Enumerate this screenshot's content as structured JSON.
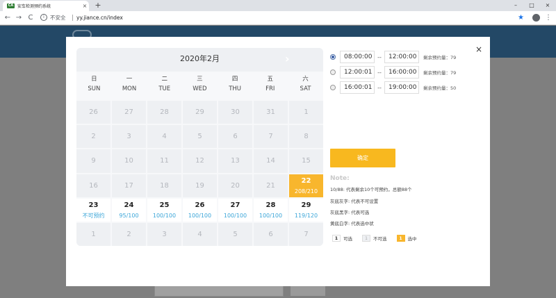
{
  "browser": {
    "tab_title": "安车检测预约系统",
    "favicon_text": "CA",
    "tab_close": "×",
    "new_tab": "+",
    "window_controls": [
      "–",
      "□",
      "×"
    ],
    "nav": {
      "back": "←",
      "forward": "→",
      "reload": "C"
    },
    "security_text": "不安全",
    "url": "yy.jiance.cn/index",
    "bookmark_icon": "★",
    "menu_icon": "⋮"
  },
  "modal": {
    "close": "×",
    "calendar": {
      "title": "2020年2月",
      "next": "›",
      "weekdays": [
        {
          "zh": "日",
          "en": "SUN"
        },
        {
          "zh": "一",
          "en": "MON"
        },
        {
          "zh": "二",
          "en": "TUE"
        },
        {
          "zh": "三",
          "en": "WED"
        },
        {
          "zh": "四",
          "en": "THU"
        },
        {
          "zh": "五",
          "en": "FRI"
        },
        {
          "zh": "六",
          "en": "SAT"
        }
      ],
      "days": [
        {
          "num": "26",
          "state": "disabled"
        },
        {
          "num": "27",
          "state": "disabled"
        },
        {
          "num": "28",
          "state": "disabled"
        },
        {
          "num": "29",
          "state": "disabled"
        },
        {
          "num": "30",
          "state": "disabled"
        },
        {
          "num": "31",
          "state": "disabled"
        },
        {
          "num": "1",
          "state": "disabled"
        },
        {
          "num": "2",
          "state": "disabled"
        },
        {
          "num": "3",
          "state": "disabled"
        },
        {
          "num": "4",
          "state": "disabled"
        },
        {
          "num": "5",
          "state": "disabled"
        },
        {
          "num": "6",
          "state": "disabled"
        },
        {
          "num": "7",
          "state": "disabled"
        },
        {
          "num": "8",
          "state": "disabled"
        },
        {
          "num": "9",
          "state": "disabled"
        },
        {
          "num": "10",
          "state": "disabled"
        },
        {
          "num": "11",
          "state": "disabled"
        },
        {
          "num": "12",
          "state": "disabled"
        },
        {
          "num": "13",
          "state": "disabled"
        },
        {
          "num": "14",
          "state": "disabled"
        },
        {
          "num": "15",
          "state": "disabled"
        },
        {
          "num": "16",
          "state": "disabled"
        },
        {
          "num": "17",
          "state": "disabled"
        },
        {
          "num": "18",
          "state": "disabled"
        },
        {
          "num": "19",
          "state": "disabled"
        },
        {
          "num": "20",
          "state": "disabled"
        },
        {
          "num": "21",
          "state": "disabled"
        },
        {
          "num": "22",
          "state": "selected",
          "quota": "208/210"
        },
        {
          "num": "23",
          "state": "avail",
          "quota": "不可预约"
        },
        {
          "num": "24",
          "state": "avail",
          "quota": "95/100"
        },
        {
          "num": "25",
          "state": "avail",
          "quota": "100/100"
        },
        {
          "num": "26",
          "state": "avail",
          "quota": "100/100"
        },
        {
          "num": "27",
          "state": "avail",
          "quota": "100/100"
        },
        {
          "num": "28",
          "state": "avail",
          "quota": "100/100"
        },
        {
          "num": "29",
          "state": "avail",
          "quota": "119/120"
        },
        {
          "num": "1",
          "state": "disabled"
        },
        {
          "num": "2",
          "state": "disabled"
        },
        {
          "num": "3",
          "state": "disabled"
        },
        {
          "num": "4",
          "state": "disabled"
        },
        {
          "num": "5",
          "state": "disabled"
        },
        {
          "num": "6",
          "state": "disabled"
        },
        {
          "num": "7",
          "state": "disabled"
        }
      ]
    },
    "slots": [
      {
        "start": "08:00:00",
        "sep": "--",
        "end": "12:00:00",
        "remain": "剩余预约量：79",
        "checked": true
      },
      {
        "start": "12:00:01",
        "sep": "--",
        "end": "16:00:00",
        "remain": "剩余预约量：79",
        "checked": false
      },
      {
        "start": "16:00:01",
        "sep": "--",
        "end": "19:00:00",
        "remain": "剩余预约量：50",
        "checked": false
      }
    ],
    "confirm_label": "确定",
    "note": {
      "title": "Note:",
      "lines": [
        "10/88: 代表剩余10个可预约，总额88个",
        "灰底灰字: 代表不可设置",
        "灰底黑字: 代表可选",
        "黄底白字: 代表选中状"
      ]
    },
    "legend": [
      {
        "box": "1",
        "style": "white",
        "label": "可选"
      },
      {
        "box": "1",
        "style": "gray",
        "label": "不可选"
      },
      {
        "box": "1",
        "style": "yellow",
        "label": "选中"
      }
    ]
  },
  "colors": {
    "header_bg": "#234866",
    "selected": "#f8b62d",
    "confirm": "#f8b81f",
    "quota_text": "#3aa5d8"
  }
}
